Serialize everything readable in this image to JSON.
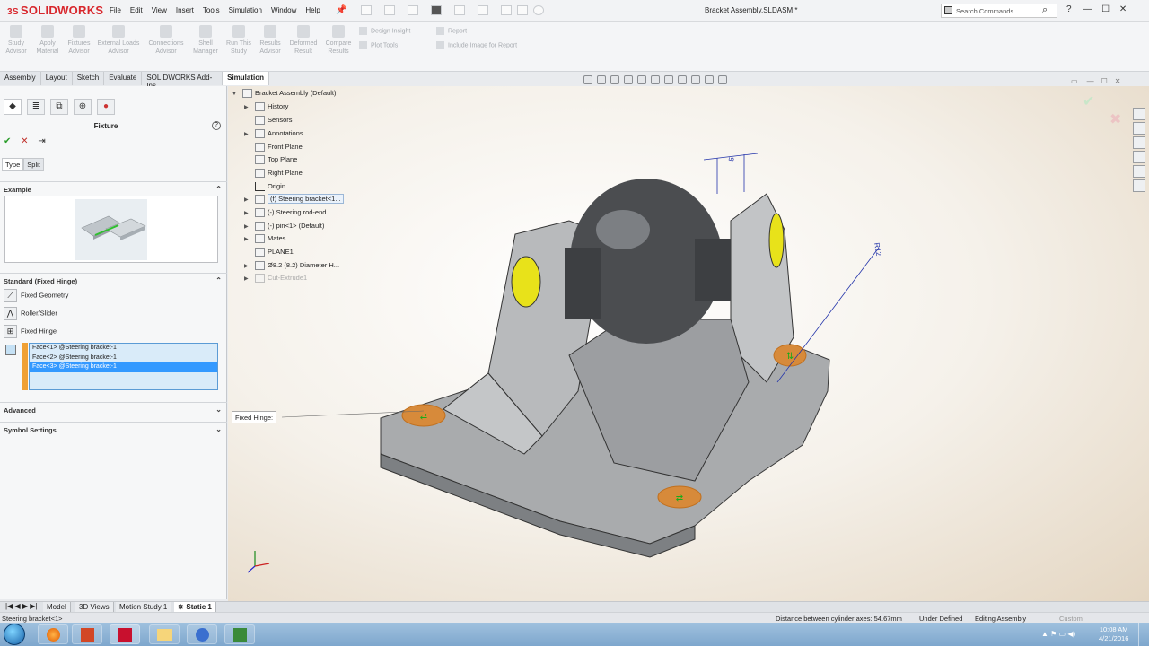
{
  "app": {
    "logo_brand": "SOLIDWORKS",
    "logo_prefix": "3S",
    "doc_title": "Bracket Assembly.SLDASM *"
  },
  "menu": [
    "File",
    "Edit",
    "View",
    "Insert",
    "Tools",
    "Simulation",
    "Window",
    "Help"
  ],
  "search": {
    "placeholder": "Search Commands"
  },
  "window_controls": {
    "help": "?",
    "min": "—",
    "max": "☐",
    "close": "✕"
  },
  "command_manager": {
    "buttons": [
      {
        "label1": "Study",
        "label2": "Advisor"
      },
      {
        "label1": "Apply",
        "label2": "Material"
      },
      {
        "label1": "Fixtures",
        "label2": "Advisor"
      },
      {
        "label1": "External Loads",
        "label2": "Advisor"
      },
      {
        "label1": "Connections",
        "label2": "Advisor"
      },
      {
        "label1": "Shell",
        "label2": "Manager"
      },
      {
        "label1": "Run This",
        "label2": "Study"
      },
      {
        "label1": "Results",
        "label2": "Advisor"
      },
      {
        "label1": "Deformed",
        "label2": "Result"
      },
      {
        "label1": "Compare",
        "label2": "Results"
      }
    ],
    "small": [
      "Design Insight",
      "Plot Tools",
      "Report",
      "Include Image for Report"
    ]
  },
  "cm_tabs": [
    "Assembly",
    "Layout",
    "Sketch",
    "Evaluate",
    "SOLIDWORKS Add-Ins",
    "Simulation"
  ],
  "property_manager": {
    "title": "Fixture",
    "help": "?",
    "ok": "✔",
    "cancel": "✕",
    "pin": "⇥",
    "subtabs": [
      "Type",
      "Split"
    ],
    "example_header": "Example",
    "standard_header": "Standard (Fixed Hinge)",
    "fixtures": [
      "Fixed Geometry",
      "Roller/Slider",
      "Fixed Hinge"
    ],
    "faces": [
      "Face<1> @Steering bracket-1",
      "Face<2> @Steering bracket-1",
      "Face<3> @Steering bracket-1"
    ],
    "advanced_header": "Advanced",
    "symbol_header": "Symbol Settings"
  },
  "tree": {
    "root": "Bracket Assembly  (Default)",
    "items": [
      {
        "label": "History",
        "expand": "▶"
      },
      {
        "label": "Sensors",
        "expand": ""
      },
      {
        "label": "Annotations",
        "expand": "▶"
      },
      {
        "label": "Front Plane",
        "expand": ""
      },
      {
        "label": "Top Plane",
        "expand": ""
      },
      {
        "label": "Right Plane",
        "expand": ""
      },
      {
        "label": "Origin",
        "expand": ""
      },
      {
        "label": "(f) Steering bracket<1...",
        "expand": "▶"
      },
      {
        "label": "(-) Steering rod-end ...",
        "expand": "▶"
      },
      {
        "label": "(-) pin<1> (Default)",
        "expand": "▶"
      },
      {
        "label": "Mates",
        "expand": "▶"
      },
      {
        "label": "PLANE1",
        "expand": ""
      },
      {
        "label": "Ø8.2 (8.2) Diameter H...",
        "expand": "▶"
      },
      {
        "label": "Cut-Extrude1",
        "expand": "▶"
      }
    ]
  },
  "viewport": {
    "callout": "Fixed Hinge:",
    "dim_5": "5",
    "dim_r12": "R12"
  },
  "bottom_tabs": [
    "Model",
    "3D Views",
    "Motion Study 1",
    "Static 1"
  ],
  "status": {
    "left": "Steering bracket<1>",
    "measure": "Distance between cylinder axes: 54.67mm",
    "defined": "Under Defined",
    "mode": "Editing Assembly",
    "units": "Custom"
  },
  "clock": {
    "time": "10:08 AM",
    "date": "4/21/2016"
  },
  "colors": {
    "accent": "#3399ff",
    "brand": "#d8262c",
    "face_orange": "#f0a033"
  }
}
